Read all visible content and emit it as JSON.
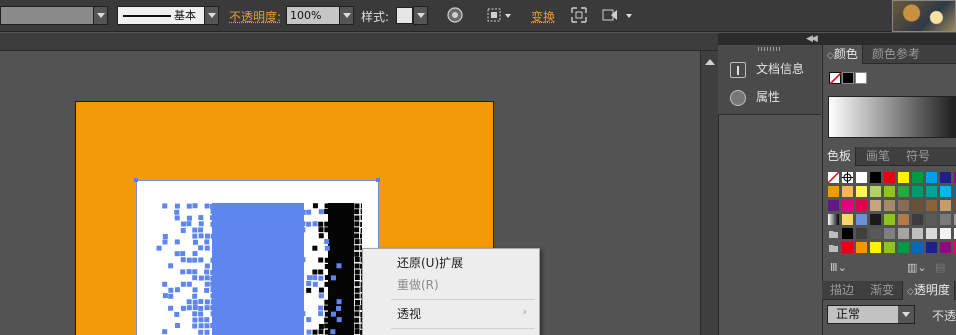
{
  "control_bar": {
    "stroke_profile_label": "基本",
    "opacity_label": "不透明度:",
    "opacity_value": "100%",
    "style_label": "样式:",
    "transform_label": "变换"
  },
  "context_menu": {
    "items": [
      {
        "label": "还原(U)扩展",
        "enabled": true
      },
      {
        "label": "重做(R)",
        "enabled": false
      },
      {
        "label": "透视",
        "enabled": true,
        "submenu": true
      }
    ]
  },
  "mid_panel": {
    "items": [
      {
        "label": "文档信息",
        "icon": "document-info-icon"
      },
      {
        "label": "属性",
        "icon": "attributes-icon"
      }
    ]
  },
  "color_panel": {
    "tabs": [
      "颜色",
      "颜色参考"
    ],
    "active_tab": "颜色"
  },
  "swatches_panel": {
    "tabs": [
      "色板",
      "画笔",
      "符号"
    ],
    "active_tab": "色板",
    "swatch_colors": [
      [
        "none",
        "reg",
        "#ffffff",
        "#000000",
        "#e60012",
        "#fff100",
        "#009944",
        "#00a0e9",
        "#1d2088",
        "#920783"
      ],
      [
        "#f29b06",
        "#f8b551",
        "#fff45c",
        "#b3d465",
        "#8fc31f",
        "#22ac38",
        "#009b6b",
        "#00a29a",
        "#00b7ee",
        "#0068b7"
      ],
      [
        "#601986",
        "#e4007f",
        "#e5004f",
        "#c4a580",
        "#a38b6c",
        "#896b52",
        "#6a5035",
        "#8c6239",
        "#c69c6d",
        "#754c24"
      ],
      [
        "gradient",
        "#f8d36c",
        "#6f8fd8",
        "#1a1a1a",
        "#8fc31f",
        "#b37a44",
        "#3c3c3c",
        "#5a5a5a",
        "#7a7a7a",
        "#9a9a9a"
      ],
      [
        "folder",
        "#000000",
        "#3f3f3f",
        "#595959",
        "#7f7f7f",
        "#a5a5a5",
        "#bfbfbf",
        "#d9d9d9",
        "#f2f2f2",
        "#ffffff"
      ],
      [
        "folder",
        "#e60012",
        "#f39800",
        "#fff100",
        "#8fc31f",
        "#009944",
        "#0068b7",
        "#1d2088",
        "#920783",
        "#e4007f"
      ]
    ]
  },
  "transparency_panel": {
    "tabs": [
      "描边",
      "渐变",
      "透明度"
    ],
    "active_tab": "透明度",
    "blend_mode": "正常",
    "opacity_label": "不透"
  }
}
